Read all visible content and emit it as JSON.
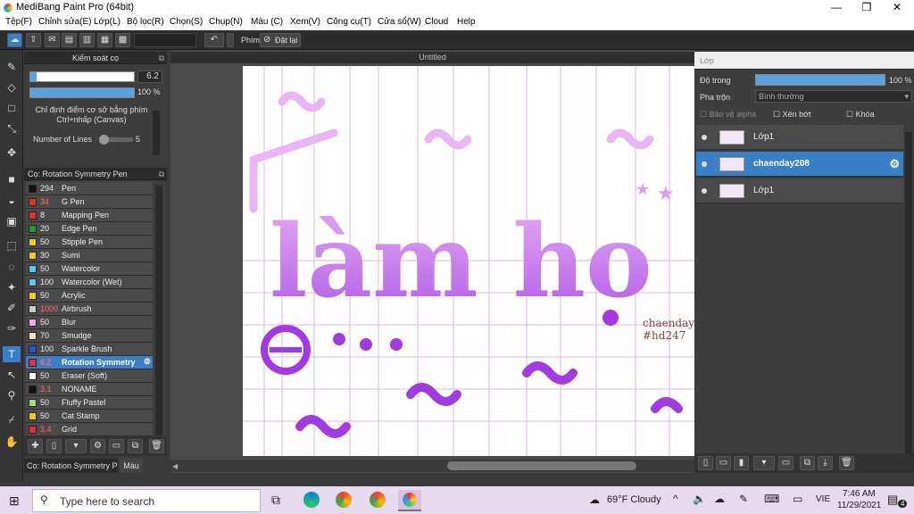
{
  "window": {
    "title": "MediBang Paint Pro (64bit)",
    "minimize": "—",
    "maximize": "❐",
    "close": "✕"
  },
  "menu": [
    "Tệp(F)",
    "Chỉnh sửa(E)",
    "Lớp(L)",
    "Bộ lọc(R)",
    "Chọn(S)",
    "Chụp(N)",
    "Màu (C)",
    "Xem(V)",
    "Công cụ(T)",
    "Cửa sổ(W)",
    "Cloud",
    "Help"
  ],
  "toolbar": {
    "phim_label": "Phím",
    "reset_label": "Đặt lại"
  },
  "brush_control": {
    "title": "Kiểm soát cọ",
    "size_value": "6.2",
    "opacity_value": "100 %",
    "hint": "Chỉ định điểm cơ sở bằng phím Ctrl+nhấp (Canvas)",
    "lines_label": "Number of Lines",
    "lines_value": "5",
    "size_fraction": 0.06,
    "opacity_fraction": 1.0
  },
  "brush_panel": {
    "title": "Cọ: Rotation Symmetry Pen",
    "brushes": [
      {
        "size": "294",
        "name": "Pen",
        "color": "#111111",
        "red": false
      },
      {
        "size": "34",
        "name": "G Pen",
        "color": "#e83030",
        "red": true
      },
      {
        "size": "8",
        "name": "Mapping Pen",
        "color": "#e83030",
        "red": false
      },
      {
        "size": "20",
        "name": "Edge Pen",
        "color": "#2a9a2a",
        "red": false
      },
      {
        "size": "50",
        "name": "Stipple Pen",
        "color": "#f0d000",
        "red": false
      },
      {
        "size": "30",
        "name": "Sumi",
        "color": "#f0d000",
        "red": false
      },
      {
        "size": "50",
        "name": "Watercolor",
        "color": "#5ac8f0",
        "red": false
      },
      {
        "size": "100",
        "name": "Watercolor (Wet)",
        "color": "#5ac8f0",
        "red": false
      },
      {
        "size": "50",
        "name": "Acrylic",
        "color": "#f0d000",
        "red": false
      },
      {
        "size": "1000",
        "name": "Airbrush",
        "color": "#cccccc",
        "red": true
      },
      {
        "size": "50",
        "name": "Blur",
        "color": "#f0a8e8",
        "red": false
      },
      {
        "size": "70",
        "name": "Smudge",
        "color": "#f0e0c0",
        "red": false
      },
      {
        "size": "100",
        "name": "Sparkle Brush",
        "color": "#2a50d8",
        "red": false
      },
      {
        "size": "6.2",
        "name": "Rotation Symmetry",
        "color": "#e83030",
        "red": true,
        "selected": true
      },
      {
        "size": "50",
        "name": "Eraser (Soft)",
        "color": "#ffffff",
        "red": false
      },
      {
        "size": "3.1",
        "name": "NONAME",
        "color": "#111111",
        "red": true
      },
      {
        "size": "50",
        "name": "Fluffy Pastel",
        "color": "#a8e070",
        "red": false
      },
      {
        "size": "50",
        "name": "Cat Stamp",
        "color": "#f0d000",
        "red": false
      },
      {
        "size": "3.4",
        "name": "Grid",
        "color": "#e83030",
        "red": true
      }
    ]
  },
  "bottom_tabs": [
    "Cọ: Rotation Symmetry Pen",
    "Màu"
  ],
  "document": {
    "tab": "Untitled",
    "text_main": "làm ho",
    "text_small_1": "chaenday20",
    "text_small_2": "#hd247"
  },
  "layer_panel": {
    "title": "Lớp",
    "opacity_label": "Độ trong",
    "opacity_value": "100 %",
    "blend_label": "Pha trộn",
    "blend_value": "Bình thường",
    "protect_alpha": "Bảo vệ alpha",
    "clipping": "Xén bớt",
    "lock": "Khóa",
    "layers": [
      {
        "name": "Lớp1",
        "selected": false
      },
      {
        "name": "chaenday208",
        "selected": true
      },
      {
        "name": "Lớp1",
        "selected": false
      }
    ]
  },
  "taskbar": {
    "search_placeholder": "Type here to search",
    "weather": "69°F  Cloudy",
    "lang": "VIE",
    "time": "7:46 AM",
    "date": "11/29/2021",
    "notif_count": "4"
  }
}
